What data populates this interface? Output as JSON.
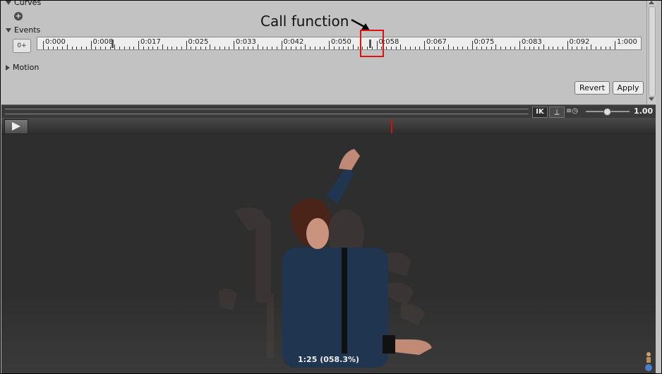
{
  "inspector": {
    "curves_label": "Curves",
    "add_symbol": "+",
    "events_label": "Events",
    "event_button_label": "0+",
    "motion_label": "Motion",
    "revert_label": "Revert",
    "apply_label": "Apply"
  },
  "timeline": {
    "ticks": [
      "0:000",
      "0:008",
      "0:017",
      "0:025",
      "0:033",
      "0:042",
      "0:050",
      "0:058",
      "0:067",
      "0:075",
      "0:083",
      "0:092",
      "1:000"
    ]
  },
  "annotation": {
    "callout": "Call function",
    "highlight_color": "#e01010"
  },
  "preview": {
    "ik_label": "IK",
    "speed_value": "1.00",
    "frame_caption": "1:25 (058.3%)",
    "playhead_color": "#cc1111"
  }
}
